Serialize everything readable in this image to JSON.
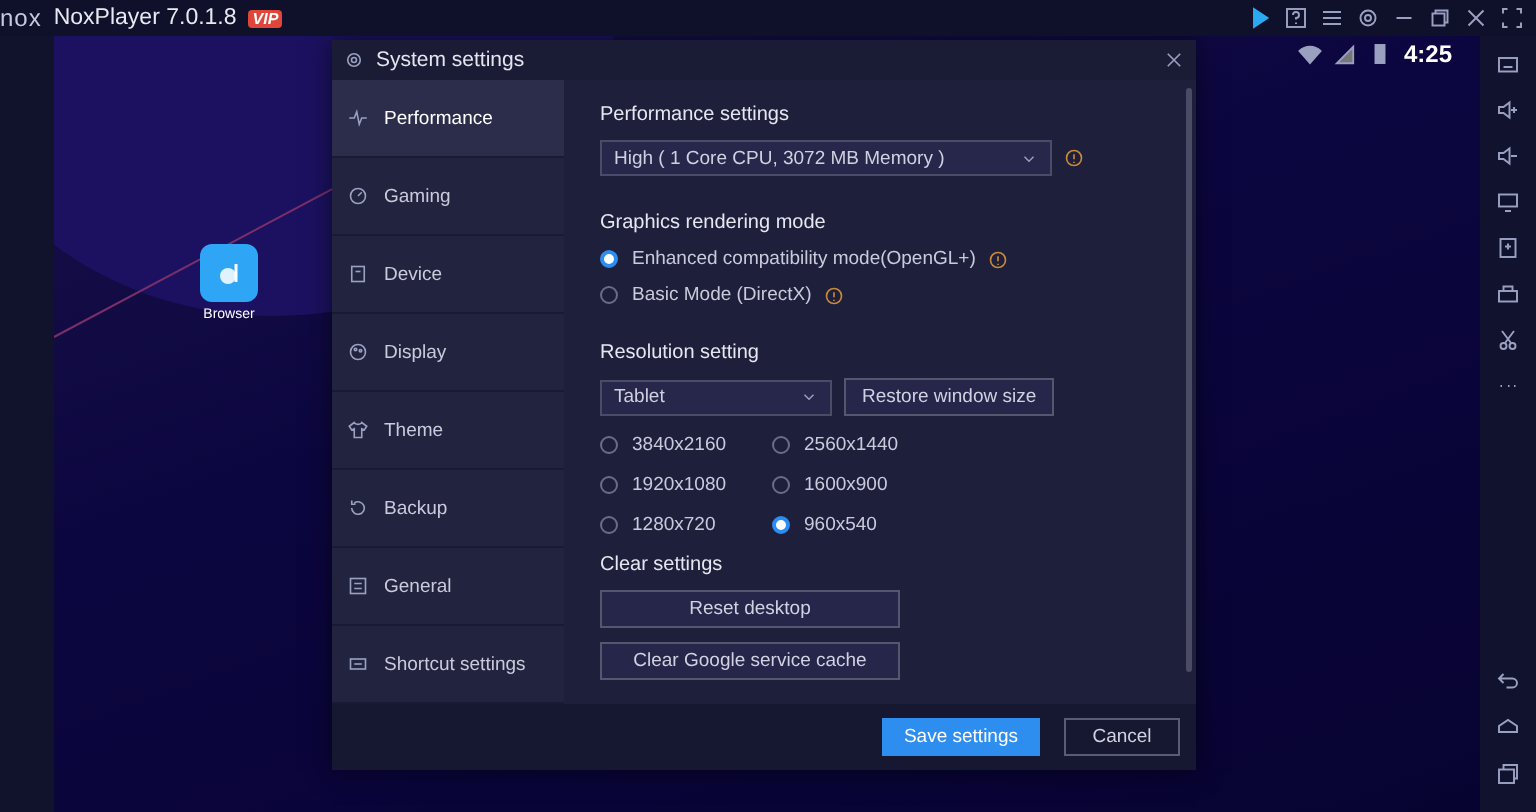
{
  "app_bar": {
    "logo": "nox",
    "title": "NoxPlayer 7.0.1.8",
    "badge": "VIP"
  },
  "status_bar": {
    "time": "4:25"
  },
  "desktop_icons": [
    {
      "label": "Browser"
    }
  ],
  "dialog": {
    "title": "System settings",
    "sidebar": [
      {
        "label": "Performance",
        "selected": true
      },
      {
        "label": "Gaming",
        "selected": false
      },
      {
        "label": "Device",
        "selected": false
      },
      {
        "label": "Display",
        "selected": false
      },
      {
        "label": "Theme",
        "selected": false
      },
      {
        "label": "Backup",
        "selected": false
      },
      {
        "label": "General",
        "selected": false
      },
      {
        "label": "Shortcut settings",
        "selected": false
      }
    ],
    "performance": {
      "heading": "Performance settings",
      "value": "High ( 1 Core CPU, 3072 MB Memory )"
    },
    "graphics": {
      "heading": "Graphics rendering mode",
      "options": [
        {
          "label": "Enhanced compatibility mode(OpenGL+)",
          "selected": true
        },
        {
          "label": "Basic Mode (DirectX)",
          "selected": false
        }
      ]
    },
    "resolution": {
      "heading": "Resolution setting",
      "mode": "Tablet",
      "restore_button": "Restore window size",
      "options": [
        {
          "label": "3840x2160",
          "selected": false
        },
        {
          "label": "2560x1440",
          "selected": false
        },
        {
          "label": "1920x1080",
          "selected": false
        },
        {
          "label": "1600x900",
          "selected": false
        },
        {
          "label": "1280x720",
          "selected": false
        },
        {
          "label": "960x540",
          "selected": true
        }
      ]
    },
    "clear": {
      "heading": "Clear settings",
      "buttons": [
        "Reset desktop",
        "Clear Google service cache"
      ]
    },
    "save_button": "Save settings",
    "cancel_button": "Cancel"
  }
}
